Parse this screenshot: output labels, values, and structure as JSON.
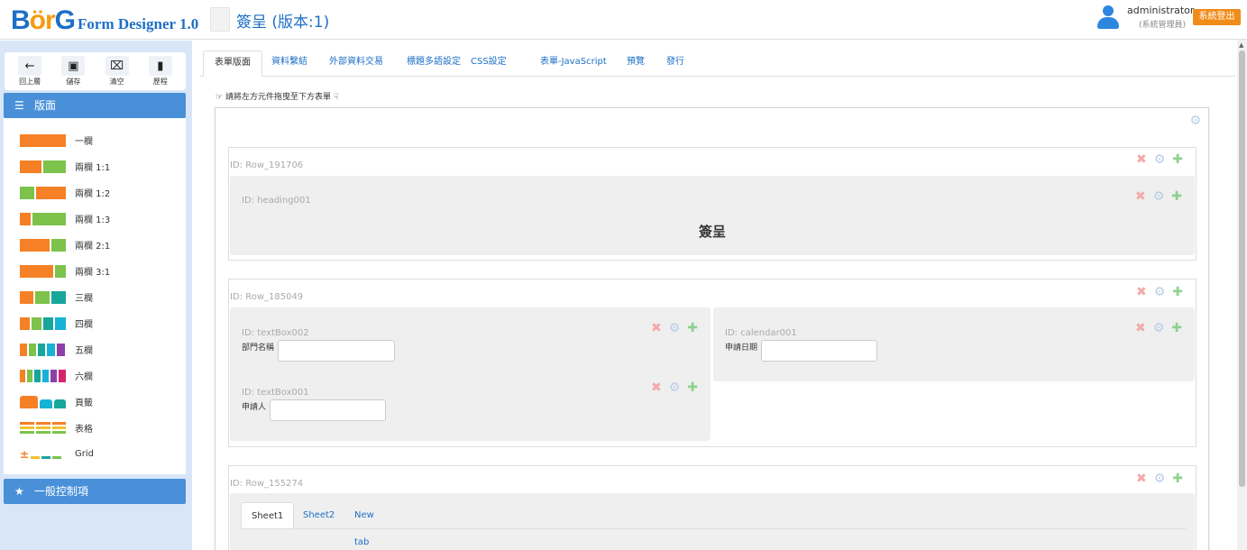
{
  "header": {
    "logo_b": "B",
    "logo_o": "ör",
    "logo_g": "G",
    "logo_sub": "Form Designer 1.0",
    "doc_title": "簽呈 (版本:1)",
    "user_name": "administrator",
    "user_role": "(系統管理員)",
    "logout_label": "系統登出"
  },
  "toolbar": [
    {
      "label": "回上層",
      "icon": "arrow-left-icon",
      "glyph": "←"
    },
    {
      "label": "儲存",
      "icon": "save-icon",
      "glyph": "💾"
    },
    {
      "label": "清空",
      "icon": "trash-icon",
      "glyph": "🗑"
    },
    {
      "label": "歷程",
      "icon": "book-icon",
      "glyph": "▮"
    }
  ],
  "sidebar": {
    "layout_header": "版面",
    "general_header": "一般控制項",
    "layout_items": [
      {
        "label": "一欄"
      },
      {
        "label": "兩欄 1:1"
      },
      {
        "label": "兩欄 1:2"
      },
      {
        "label": "兩欄 1:3"
      },
      {
        "label": "兩欄 2:1"
      },
      {
        "label": "兩欄 3:1"
      },
      {
        "label": "三欄"
      },
      {
        "label": "四欄"
      },
      {
        "label": "五欄"
      },
      {
        "label": "六欄"
      },
      {
        "label": "頁籤"
      },
      {
        "label": "表格"
      },
      {
        "label": "Grid"
      }
    ]
  },
  "tabs": [
    "表單版面",
    "資料繫結",
    "外部資料交易",
    "標題多語設定",
    "CSS設定",
    "表單-JavaScript",
    "預覽",
    "發行"
  ],
  "active_tab": 0,
  "hint": "請將左方元件拖曳至下方表單",
  "rows": {
    "row1": {
      "id": "ID: Row_191706",
      "heading_id": "ID: heading001",
      "heading_text": "簽呈"
    },
    "row2": {
      "id": "ID: Row_185049",
      "textbox002_id": "ID: textBox002",
      "textbox002_label": "部門名稱",
      "calendar_id": "ID: calendar001",
      "calendar_label": "申請日期",
      "textbox001_id": "ID: textBox001",
      "textbox001_label": "申請人"
    },
    "row3": {
      "id": "ID: Row_155274",
      "tabs": [
        "Sheet1",
        "Sheet2",
        "New tab"
      ]
    }
  }
}
